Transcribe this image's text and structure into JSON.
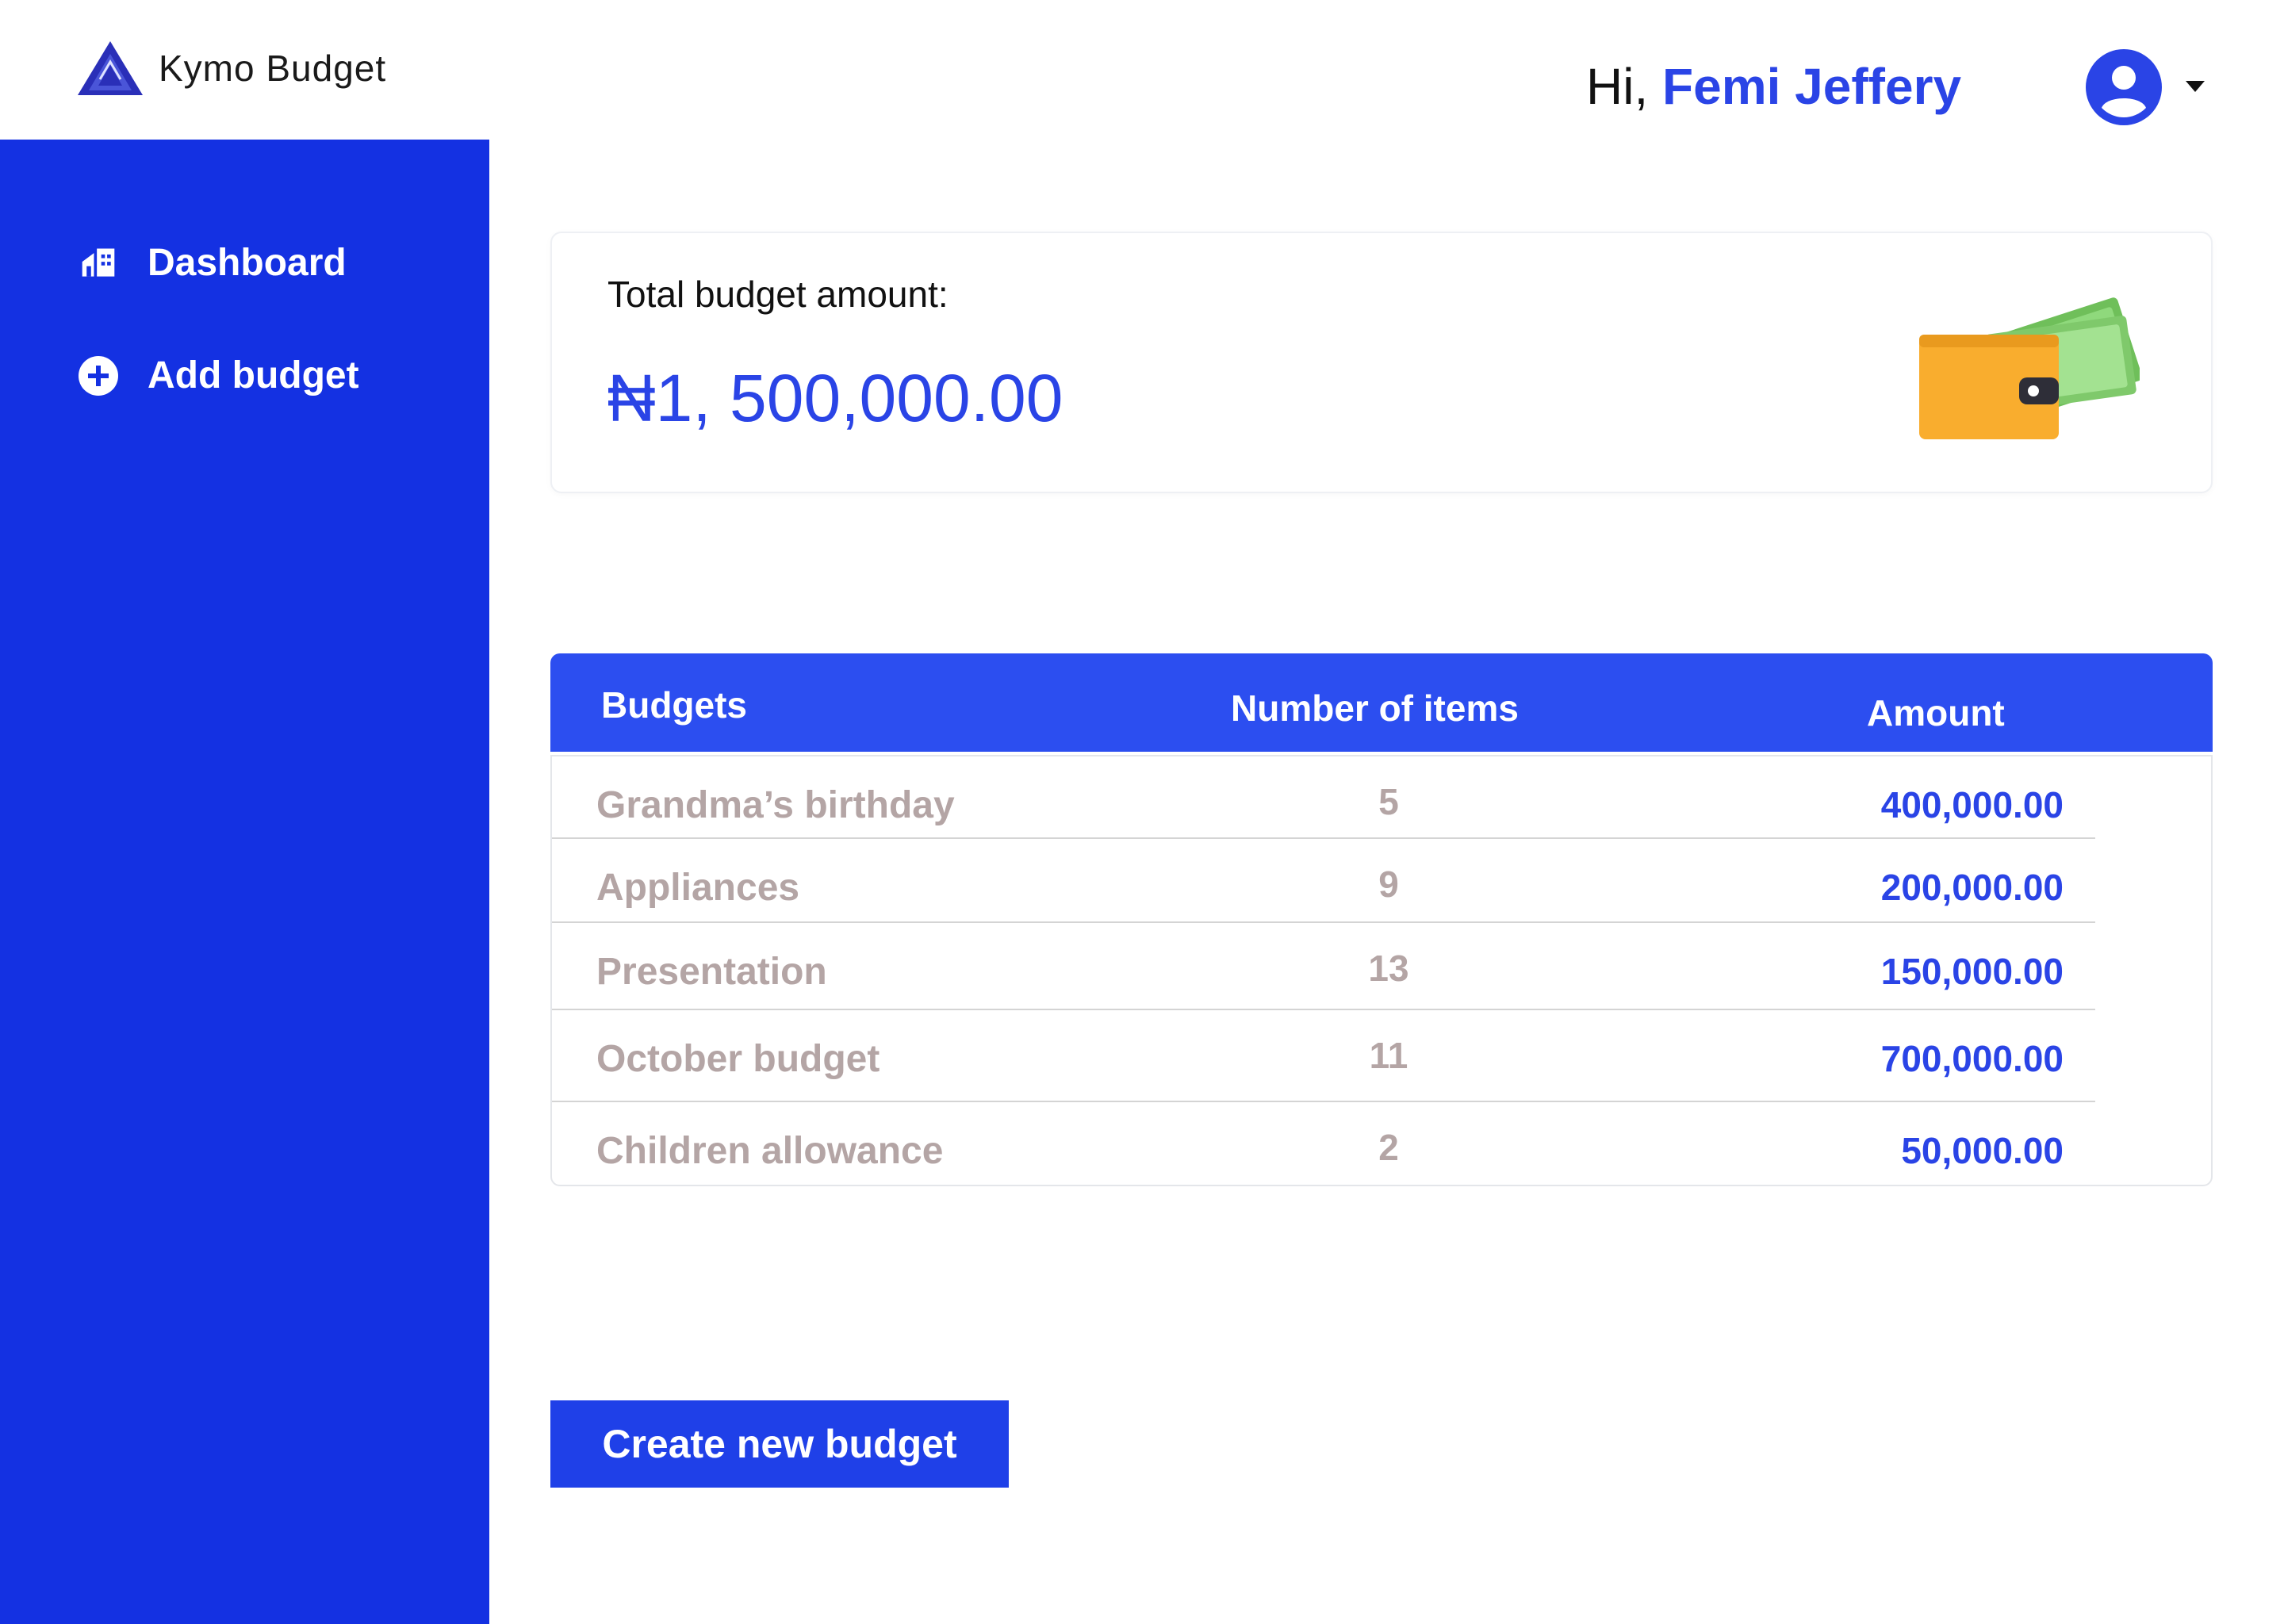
{
  "app": {
    "title": "Kymo Budget"
  },
  "header": {
    "greeting": "Hi,",
    "user_name": "Femi Jeffery"
  },
  "sidebar": {
    "items": [
      {
        "label": "Dashboard",
        "icon": "home-icon"
      },
      {
        "label": "Add budget",
        "icon": "plus-circle-icon"
      }
    ]
  },
  "summary": {
    "label": "Total budget amount:",
    "amount": "₦1, 500,000.00",
    "icon": "wallet-icon"
  },
  "table": {
    "headers": [
      "Budgets",
      "Number of items",
      "Amount"
    ],
    "rows": [
      {
        "name": "Grandma’s birthday",
        "items": "5",
        "amount": "400,000.00"
      },
      {
        "name": "Appliances",
        "items": "9",
        "amount": "200,000.00"
      },
      {
        "name": "Presentation",
        "items": "13",
        "amount": "150,000.00"
      },
      {
        "name": "October budget",
        "items": "11",
        "amount": "700,000.00"
      },
      {
        "name": "Children allowance",
        "items": "2",
        "amount": "50,000.00"
      }
    ]
  },
  "actions": {
    "create_label": "Create new budget"
  },
  "colors": {
    "sidebar": "#1431e2",
    "accent": "#2a44e6",
    "table_header": "#2c4ef0",
    "muted_text": "#b4a5a5",
    "wallet": "#f9ad2e",
    "cash": "#7fc96b"
  }
}
